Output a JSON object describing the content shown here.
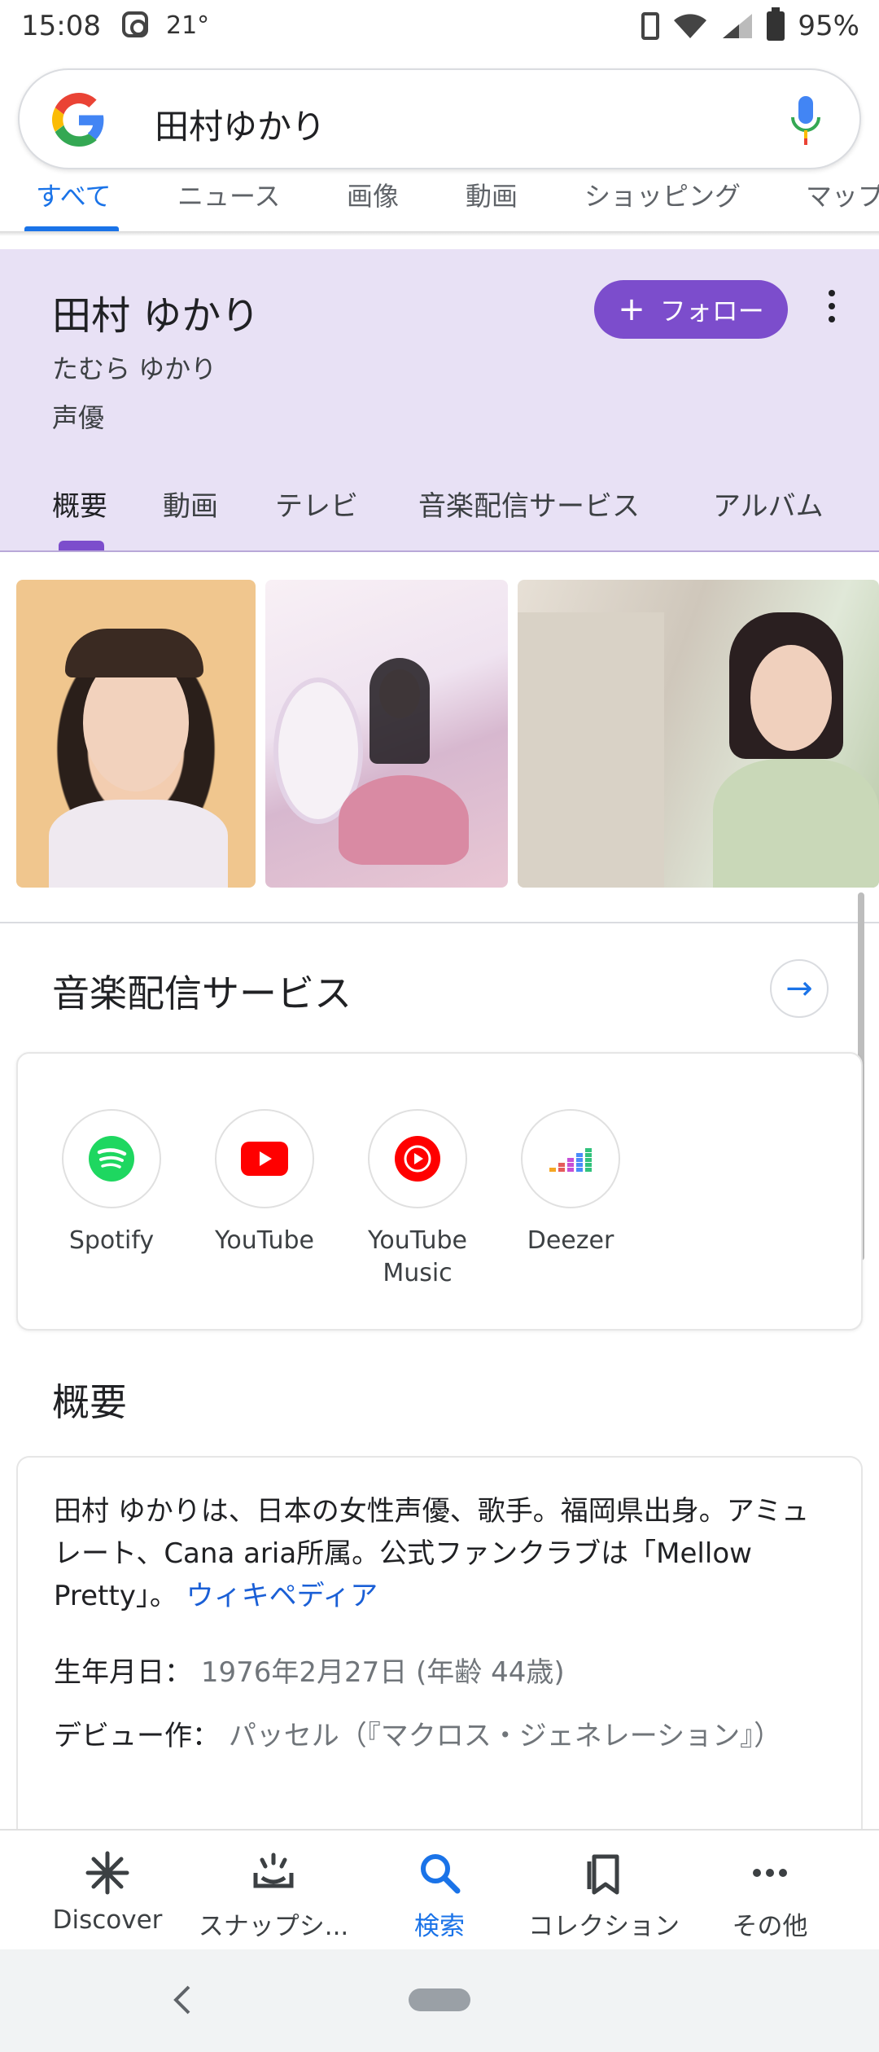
{
  "status_bar": {
    "time": "15:08",
    "temperature": "21°",
    "battery": "95%"
  },
  "search": {
    "query": "田村ゆかり"
  },
  "tabs": [
    {
      "label": "すべて",
      "active": true
    },
    {
      "label": "ニュース"
    },
    {
      "label": "画像"
    },
    {
      "label": "動画"
    },
    {
      "label": "ショッピング"
    },
    {
      "label": "マップ"
    }
  ],
  "knowledge_panel": {
    "title": "田村 ゆかり",
    "reading": "たむら ゆかり",
    "type": "声優",
    "follow_label": "フォロー",
    "tabs": [
      {
        "label": "概要",
        "active": true
      },
      {
        "label": "動画"
      },
      {
        "label": "テレビ"
      },
      {
        "label": "音楽配信サービス"
      },
      {
        "label": "アルバム"
      }
    ]
  },
  "music": {
    "title": "音楽配信サービス",
    "services": [
      {
        "name": "Spotify",
        "color": "#1ed760"
      },
      {
        "name": "YouTube",
        "color": "#ff0000"
      },
      {
        "name": "YouTube Music",
        "color": "#ff0000"
      },
      {
        "name": "Deezer",
        "color": "#a238ff"
      }
    ]
  },
  "overview": {
    "title": "概要",
    "description": "田村 ゆかりは、日本の女性声優、歌手。福岡県出身。アミュレート、Cana aria所属。公式ファンクラブは「Mellow Pretty」。",
    "source_link": "ウィキペディア",
    "birth_label": "生年月日：",
    "birth_value": "1976年2月27日 (年齢 44歳)",
    "debut_label": "デビュー作：",
    "debut_value": "パッセル（『マクロス・ジェネレーション』）"
  },
  "bottom_nav": [
    {
      "label": "Discover",
      "icon": "asterisk-icon"
    },
    {
      "label": "スナップシ...",
      "icon": "snapshot-icon"
    },
    {
      "label": "検索",
      "icon": "search-icon",
      "active": true
    },
    {
      "label": "コレクション",
      "icon": "collections-icon"
    },
    {
      "label": "その他",
      "icon": "more-horiz-icon"
    }
  ],
  "colors": {
    "accent": "#1a73e8",
    "panel_bg": "#e8e1f5",
    "follow_bg": "#7c4dcc"
  }
}
